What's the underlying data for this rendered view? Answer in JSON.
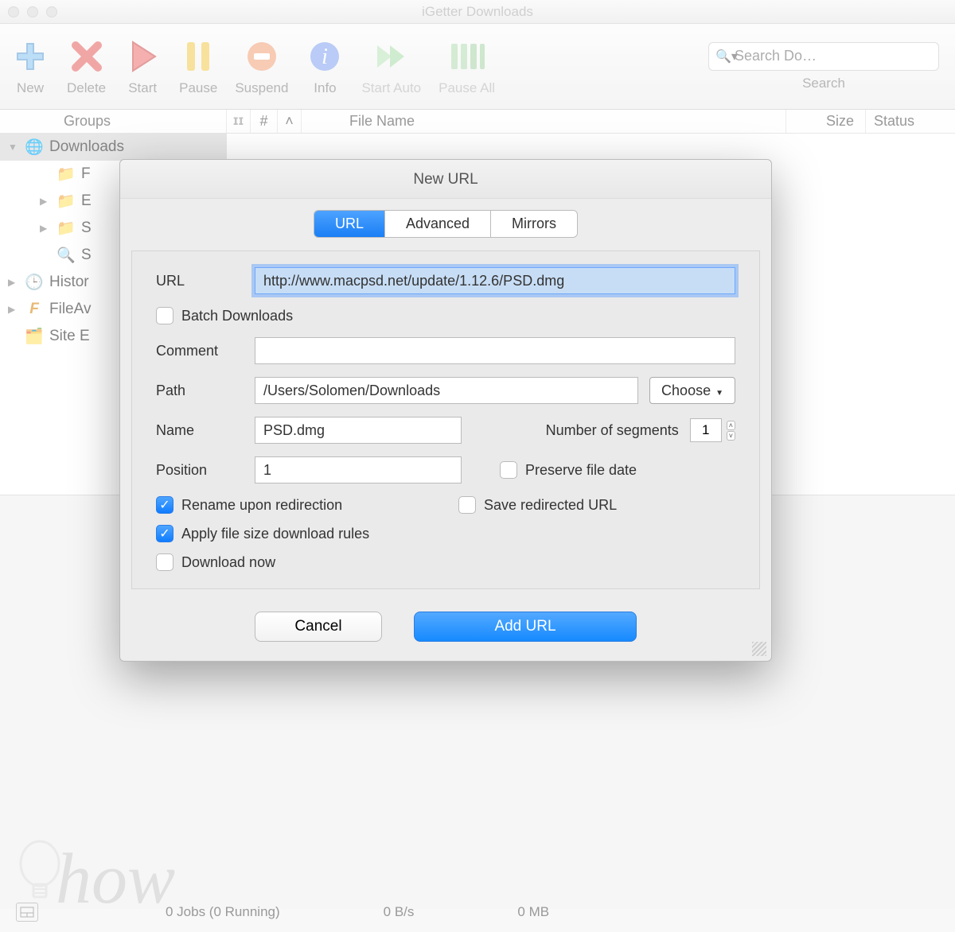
{
  "window": {
    "title": "iGetter Downloads"
  },
  "toolbar": {
    "items": [
      {
        "label": "New"
      },
      {
        "label": "Delete"
      },
      {
        "label": "Start"
      },
      {
        "label": "Pause"
      },
      {
        "label": "Suspend"
      },
      {
        "label": "Info"
      },
      {
        "label": "Start Auto"
      },
      {
        "label": "Pause All"
      }
    ],
    "search_placeholder": "Search Do…",
    "search_label": "Search"
  },
  "columns": {
    "groups": "Groups",
    "pause_glyph": "𝗜𝗜",
    "hash": "#",
    "sort": "˄",
    "filename": "File Name",
    "size": "Size",
    "status": "Status"
  },
  "sidebar": {
    "items": [
      {
        "label": "Downloads"
      },
      {
        "label": "F"
      },
      {
        "label": "E"
      },
      {
        "label": "S"
      },
      {
        "label": "S"
      },
      {
        "label": "Histor"
      },
      {
        "label": "FileAv"
      },
      {
        "label": "Site E"
      }
    ]
  },
  "dialog": {
    "title": "New URL",
    "tabs": {
      "url": "URL",
      "advanced": "Advanced",
      "mirrors": "Mirrors"
    },
    "labels": {
      "url": "URL",
      "batch": "Batch Downloads",
      "comment": "Comment",
      "path": "Path",
      "choose": "Choose",
      "name": "Name",
      "segments": "Number of segments",
      "position": "Position",
      "preserve": "Preserve file date",
      "rename": "Rename upon redirection",
      "save_redirected": "Save redirected URL",
      "apply_rules": "Apply file size download rules",
      "download_now": "Download now"
    },
    "values": {
      "url": "http://www.macpsd.net/update/1.12.6/PSD.dmg",
      "comment": "",
      "path": "/Users/Solomen/Downloads",
      "name": "PSD.dmg",
      "segments": "1",
      "position": "1",
      "batch_checked": false,
      "preserve_checked": false,
      "rename_checked": true,
      "save_redirected_checked": false,
      "apply_rules_checked": true,
      "download_now_checked": false
    },
    "buttons": {
      "cancel": "Cancel",
      "add": "Add URL"
    }
  },
  "statusbar": {
    "jobs": "0 Jobs (0 Running)",
    "speed": "0 B/s",
    "size": "0 MB"
  },
  "watermark": "how"
}
